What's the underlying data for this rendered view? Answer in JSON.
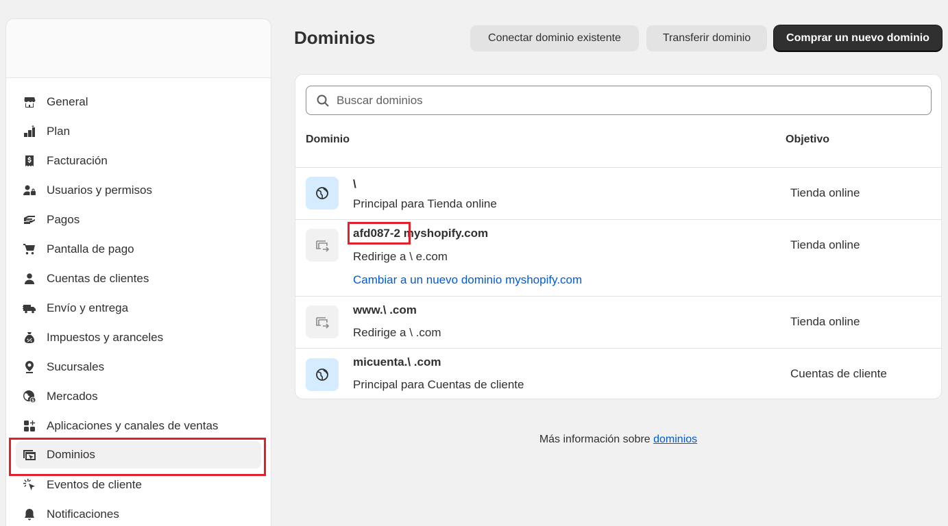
{
  "sidebar": {
    "items": [
      {
        "label": "General",
        "icon": "store-icon"
      },
      {
        "label": "Plan",
        "icon": "plan-icon"
      },
      {
        "label": "Facturación",
        "icon": "receipt-icon"
      },
      {
        "label": "Usuarios y permisos",
        "icon": "users-icon"
      },
      {
        "label": "Pagos",
        "icon": "payments-icon"
      },
      {
        "label": "Pantalla de pago",
        "icon": "cart-icon"
      },
      {
        "label": "Cuentas de clientes",
        "icon": "person-icon"
      },
      {
        "label": "Envío y entrega",
        "icon": "truck-icon"
      },
      {
        "label": "Impuestos y aranceles",
        "icon": "tax-icon"
      },
      {
        "label": "Sucursales",
        "icon": "location-icon"
      },
      {
        "label": "Mercados",
        "icon": "globe-icon"
      },
      {
        "label": "Aplicaciones y canales de ventas",
        "icon": "apps-icon"
      },
      {
        "label": "Dominios",
        "icon": "domains-icon",
        "active": true
      },
      {
        "label": "Eventos de cliente",
        "icon": "cursor-click-icon"
      },
      {
        "label": "Notificaciones",
        "icon": "bell-icon"
      }
    ]
  },
  "header": {
    "title": "Dominios",
    "connect_label": "Conectar dominio existente",
    "transfer_label": "Transferir dominio",
    "buy_label": "Comprar un nuevo dominio"
  },
  "search": {
    "placeholder": "Buscar dominios"
  },
  "table": {
    "col_domain": "Dominio",
    "col_objective": "Objetivo",
    "rows": [
      {
        "name": "\\",
        "subtitle": "Principal para Tienda online",
        "objective": "Tienda online",
        "icon": "globe-icon"
      },
      {
        "name": "afd087-2 myshopify.com",
        "subtitle": "Redirige a \\                e.com",
        "link": "Cambiar a un nuevo dominio myshopify.com",
        "objective": "Tienda online",
        "icon": "redirect-icon"
      },
      {
        "name": "www.\\                .com",
        "subtitle": "Redirige a \\                  .com",
        "objective": "Tienda online",
        "icon": "redirect-icon"
      },
      {
        "name": "micuenta.\\                .com",
        "subtitle": "Principal para Cuentas de cliente",
        "objective": "Cuentas de cliente",
        "icon": "globe-icon"
      }
    ]
  },
  "footer": {
    "text": "Más información sobre ",
    "link": "dominios"
  },
  "colors": {
    "highlight": "#e0202a",
    "link": "#005bd3",
    "primary_button": "#303030"
  }
}
